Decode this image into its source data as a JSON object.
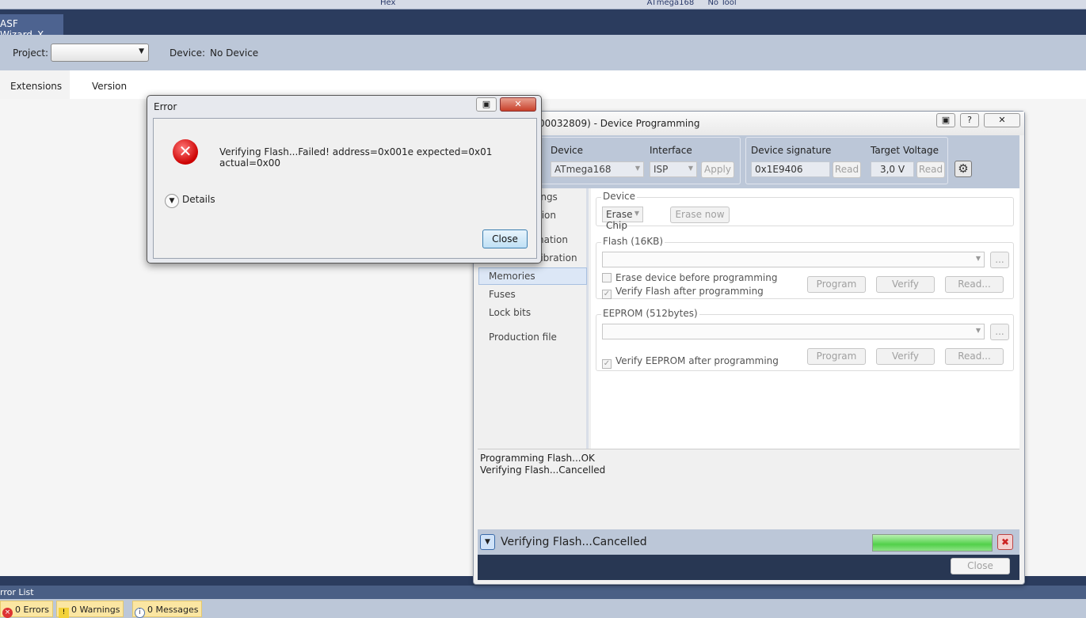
{
  "toolbar": {
    "items": [
      "Hex",
      "ATmega168",
      "No Tool"
    ]
  },
  "tab": {
    "label": "ASF Wizard",
    "close": "X"
  },
  "project": {
    "label": "Project:",
    "value": "",
    "device_label": "Device:",
    "device_value": "No Device"
  },
  "ext_tabs": [
    "Extensions",
    "Version"
  ],
  "error_dialog": {
    "title": "Error",
    "message": "Verifying Flash...Failed! address=0x001e expected=0x01 actual=0x00",
    "details": "Details",
    "close": "Close"
  },
  "dp": {
    "title": "00032809) - Device Programming",
    "device_label": "Device",
    "device_value": "ATmega168",
    "interface_label": "Interface",
    "interface_value": "ISP",
    "apply": "Apply",
    "sig_label": "Device signature",
    "sig_value": "0x1E9406",
    "read": "Read",
    "volt_label": "Target Voltage",
    "volt_value": "3,0 V",
    "nav": [
      "ings",
      "tion",
      "nation",
      "libration",
      "Memories",
      "Fuses",
      "Lock bits",
      "Production file"
    ],
    "device_group": "Device",
    "erase_mode": "Erase Chip",
    "erase_now": "Erase now",
    "flash_group": "Flash (16KB)",
    "erase_before": "Erase device before programming",
    "verify_flash": "Verify Flash after programming",
    "program": "Program",
    "verify": "Verify",
    "read_dots": "Read...",
    "browse": "...",
    "eeprom_group": "EEPROM (512bytes)",
    "verify_eeprom": "Verify EEPROM after programming",
    "log": [
      "Programming Flash...OK",
      "Verifying Flash...Cancelled"
    ],
    "status": "Verifying Flash...Cancelled",
    "progress": 1.0,
    "close": "Close"
  },
  "error_list": {
    "title": "rror List",
    "errors": "0 Errors",
    "warnings": "0 Warnings",
    "messages": "0 Messages"
  }
}
